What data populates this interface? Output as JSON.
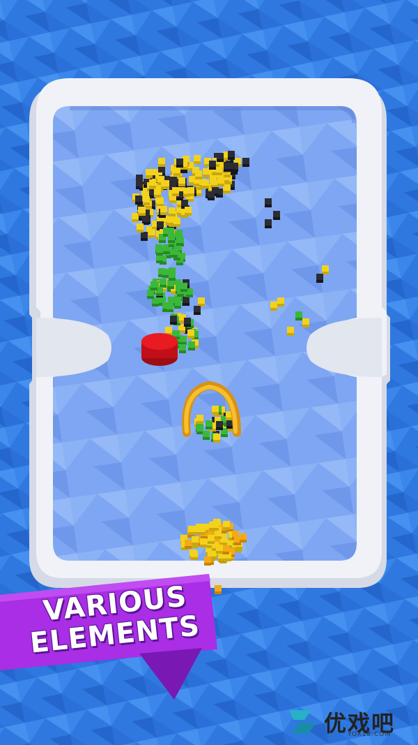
{
  "banner": {
    "line1": "VARIOUS",
    "line2": "ELEMENTS"
  },
  "watermark": {
    "name": "优戏吧",
    "url": "YOX18.COM"
  },
  "colors": {
    "water": "#2f78e0",
    "floor": "#7ea6f2",
    "wall": "#e8ecf4",
    "ball": "#e8141e",
    "scoop": "#f0b21c",
    "banner": "#a92ee6",
    "cube_yellow": "#f3d21c",
    "cube_black": "#2c2c34",
    "cube_green": "#3bb83a",
    "cube_orange": "#f5a916"
  },
  "icons": [
    "ball-icon",
    "scoop-icon",
    "logo-icon"
  ]
}
